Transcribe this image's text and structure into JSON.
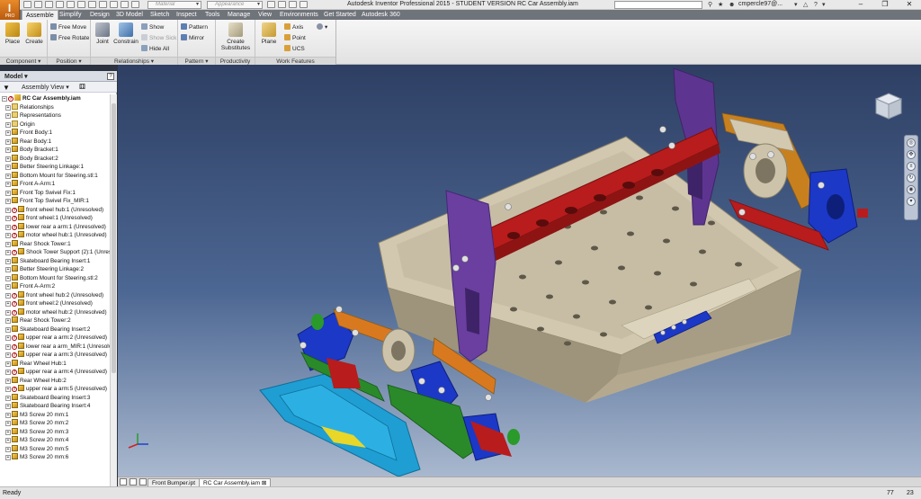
{
  "app": {
    "logo_text": "I",
    "logo_sub": "PRO",
    "window_title": "Autodesk Inventor Professional 2015 - STUDENT VERSION   RC Car Assembly.iam",
    "user_name": "cmpercle97@...",
    "material_placeholder": "Material",
    "appearance_placeholder": "Appearance"
  },
  "ribbon_tabs": [
    {
      "label": "Assemble",
      "active": true
    },
    {
      "label": "Simplify"
    },
    {
      "label": "Design"
    },
    {
      "label": "3D Model"
    },
    {
      "label": "Sketch"
    },
    {
      "label": "Inspect"
    },
    {
      "label": "Tools"
    },
    {
      "label": "Manage"
    },
    {
      "label": "View"
    },
    {
      "label": "Environments"
    },
    {
      "label": "Get Started"
    },
    {
      "label": "Autodesk 360"
    }
  ],
  "ribbon": {
    "component": {
      "label": "Component ▾",
      "place": "Place",
      "create": "Create"
    },
    "position": {
      "label": "Position ▾",
      "free_move": "Free Move",
      "free_rotate": "Free Rotate"
    },
    "relationships": {
      "label": "Relationships ▾",
      "joint": "Joint",
      "constrain": "Constrain",
      "show": "Show",
      "show_sick": "Show Sick",
      "hide_all": "Hide All"
    },
    "pattern": {
      "label": "Pattern ▾",
      "pattern": "Pattern",
      "mirror": "Mirror"
    },
    "productivity": {
      "label": "Productivity",
      "create_substitutes": "Create Substitutes"
    },
    "work_features": {
      "label": "Work Features",
      "plane": "Plane",
      "axis": "Axis",
      "point": "Point",
      "ucs": "UCS"
    }
  },
  "browser": {
    "title": "Model ▾",
    "help": "?",
    "assembly_view": "Assembly View ▾",
    "items": [
      {
        "label": "RC Car Assembly.iam",
        "level": 0,
        "root": true,
        "warn": true
      },
      {
        "label": "Relationships",
        "level": 1,
        "icon": "folder"
      },
      {
        "label": "Representations",
        "level": 1,
        "icon": "folder"
      },
      {
        "label": "Origin",
        "level": 1,
        "icon": "folder"
      },
      {
        "label": "Front Body:1",
        "level": 1,
        "icon": "part"
      },
      {
        "label": "Rear Body:1",
        "level": 1,
        "icon": "part"
      },
      {
        "label": "Body Bracket:1",
        "level": 1,
        "icon": "part"
      },
      {
        "label": "Body Bracket:2",
        "level": 1,
        "icon": "part"
      },
      {
        "label": "Better Steering Linkage:1",
        "level": 1,
        "icon": "part"
      },
      {
        "label": "Bottom Mount for Steering.stl:1",
        "level": 1,
        "icon": "part"
      },
      {
        "label": "Front A-Arm:1",
        "level": 1,
        "icon": "part"
      },
      {
        "label": "Front Top Swivel Fix:1",
        "level": 1,
        "icon": "part"
      },
      {
        "label": "Front Top Swivel Fix_MIR:1",
        "level": 1,
        "icon": "part"
      },
      {
        "label": "front wheel hub:1 (Unresolved)",
        "level": 1,
        "icon": "part",
        "warn": true
      },
      {
        "label": "front wheel:1 (Unresolved)",
        "level": 1,
        "icon": "part",
        "warn": true
      },
      {
        "label": "lower rear a arm:1 (Unresolved)",
        "level": 1,
        "icon": "part",
        "warn": true
      },
      {
        "label": "motor wheel hub:1 (Unresolved)",
        "level": 1,
        "icon": "part",
        "warn": true
      },
      {
        "label": "Rear Shock Tower:1",
        "level": 1,
        "icon": "part"
      },
      {
        "label": "Shock Tower Support (2):1 (Unres",
        "level": 1,
        "icon": "part",
        "warn": true
      },
      {
        "label": "Skateboard Bearing Insert:1",
        "level": 1,
        "icon": "part"
      },
      {
        "label": "Better Steering Linkage:2",
        "level": 1,
        "icon": "part"
      },
      {
        "label": "Bottom Mount for Steering.stl:2",
        "level": 1,
        "icon": "part"
      },
      {
        "label": "Front A-Arm:2",
        "level": 1,
        "icon": "part"
      },
      {
        "label": "front wheel hub:2 (Unresolved)",
        "level": 1,
        "icon": "part",
        "warn": true
      },
      {
        "label": "front wheel:2 (Unresolved)",
        "level": 1,
        "icon": "part",
        "warn": true
      },
      {
        "label": "motor wheel hub:2 (Unresolved)",
        "level": 1,
        "icon": "part",
        "warn": true
      },
      {
        "label": "Rear Shock Tower:2",
        "level": 1,
        "icon": "part"
      },
      {
        "label": "Skateboard Bearing Insert:2",
        "level": 1,
        "icon": "part"
      },
      {
        "label": "upper rear a arm:2 (Unresolved)",
        "level": 1,
        "icon": "part",
        "warn": true
      },
      {
        "label": "lower rear a arm_MIR:1 (Unresolved)",
        "level": 1,
        "icon": "part",
        "warn": true
      },
      {
        "label": "upper rear a arm:3 (Unresolved)",
        "level": 1,
        "icon": "part",
        "warn": true
      },
      {
        "label": "Rear Wheel Hub:1",
        "level": 1,
        "icon": "part"
      },
      {
        "label": "upper rear a arm:4 (Unresolved)",
        "level": 1,
        "icon": "part",
        "warn": true
      },
      {
        "label": "Rear Wheel Hub:2",
        "level": 1,
        "icon": "part"
      },
      {
        "label": "upper rear a arm:5 (Unresolved)",
        "level": 1,
        "icon": "part",
        "warn": true
      },
      {
        "label": "Skateboard Bearing Insert:3",
        "level": 1,
        "icon": "part"
      },
      {
        "label": "Skateboard Bearing Insert:4",
        "level": 1,
        "icon": "part"
      },
      {
        "label": "M3 Screw 20 mm:1",
        "level": 1,
        "icon": "part"
      },
      {
        "label": "M3 Screw 20 mm:2",
        "level": 1,
        "icon": "part"
      },
      {
        "label": "M3 Screw 20 mm:3",
        "level": 1,
        "icon": "part"
      },
      {
        "label": "M3 Screw 20 mm:4",
        "level": 1,
        "icon": "part"
      },
      {
        "label": "M3 Screw 20 mm:5",
        "level": 1,
        "icon": "part"
      },
      {
        "label": "M3 Screw 20 mm:6",
        "level": 1,
        "icon": "part"
      }
    ]
  },
  "doc_tabs": [
    {
      "label": "Front Bumper.ipt",
      "active": false
    },
    {
      "label": "RC Car Assembly.iam  ⊠",
      "active": true
    }
  ],
  "status": {
    "text": "Ready",
    "num1": "77",
    "num2": "23"
  },
  "colors": {
    "chassis": "#c9bfa8",
    "tower": "#6a3fa0",
    "beam": "#c8201f",
    "arm": "#d9791f",
    "hub": "#1c38c7",
    "bumper": "#1f9ed3"
  }
}
